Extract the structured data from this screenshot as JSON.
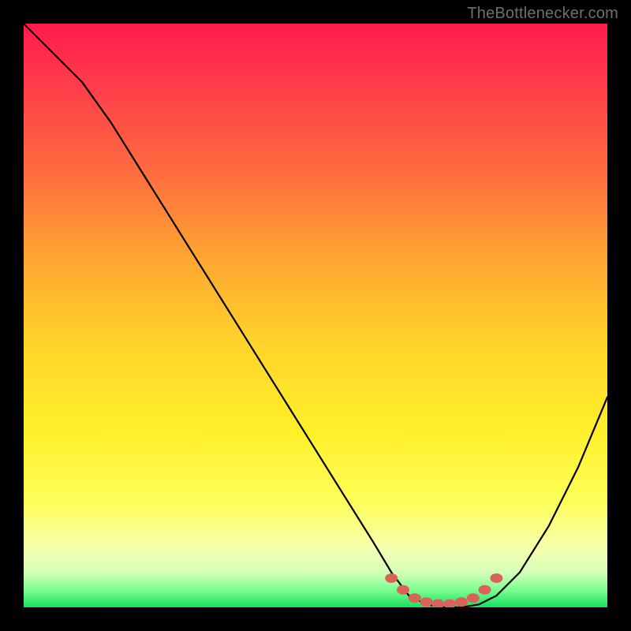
{
  "attribution": "TheBottlenecker.com",
  "chart_data": {
    "type": "line",
    "title": "",
    "xlabel": "",
    "ylabel": "",
    "xlim": [
      0,
      100
    ],
    "ylim": [
      0,
      100
    ],
    "series": [
      {
        "name": "bottleneck-curve",
        "x": [
          0,
          5,
          10,
          15,
          20,
          25,
          30,
          35,
          40,
          45,
          50,
          55,
          60,
          63,
          66,
          69,
          72,
          75,
          78,
          81,
          85,
          90,
          95,
          100
        ],
        "values": [
          100,
          95,
          90,
          83,
          75,
          67,
          59,
          51,
          43,
          35,
          27,
          19,
          11,
          6,
          2,
          0.5,
          0,
          0,
          0.5,
          2,
          6,
          14,
          24,
          36
        ]
      }
    ],
    "markers": {
      "name": "highlight-dots",
      "color": "#d9635b",
      "x": [
        63,
        65,
        67,
        69,
        71,
        73,
        75,
        77,
        79,
        81
      ],
      "values": [
        5.0,
        3.0,
        1.6,
        0.9,
        0.6,
        0.6,
        0.9,
        1.6,
        3.0,
        5.0
      ]
    }
  }
}
